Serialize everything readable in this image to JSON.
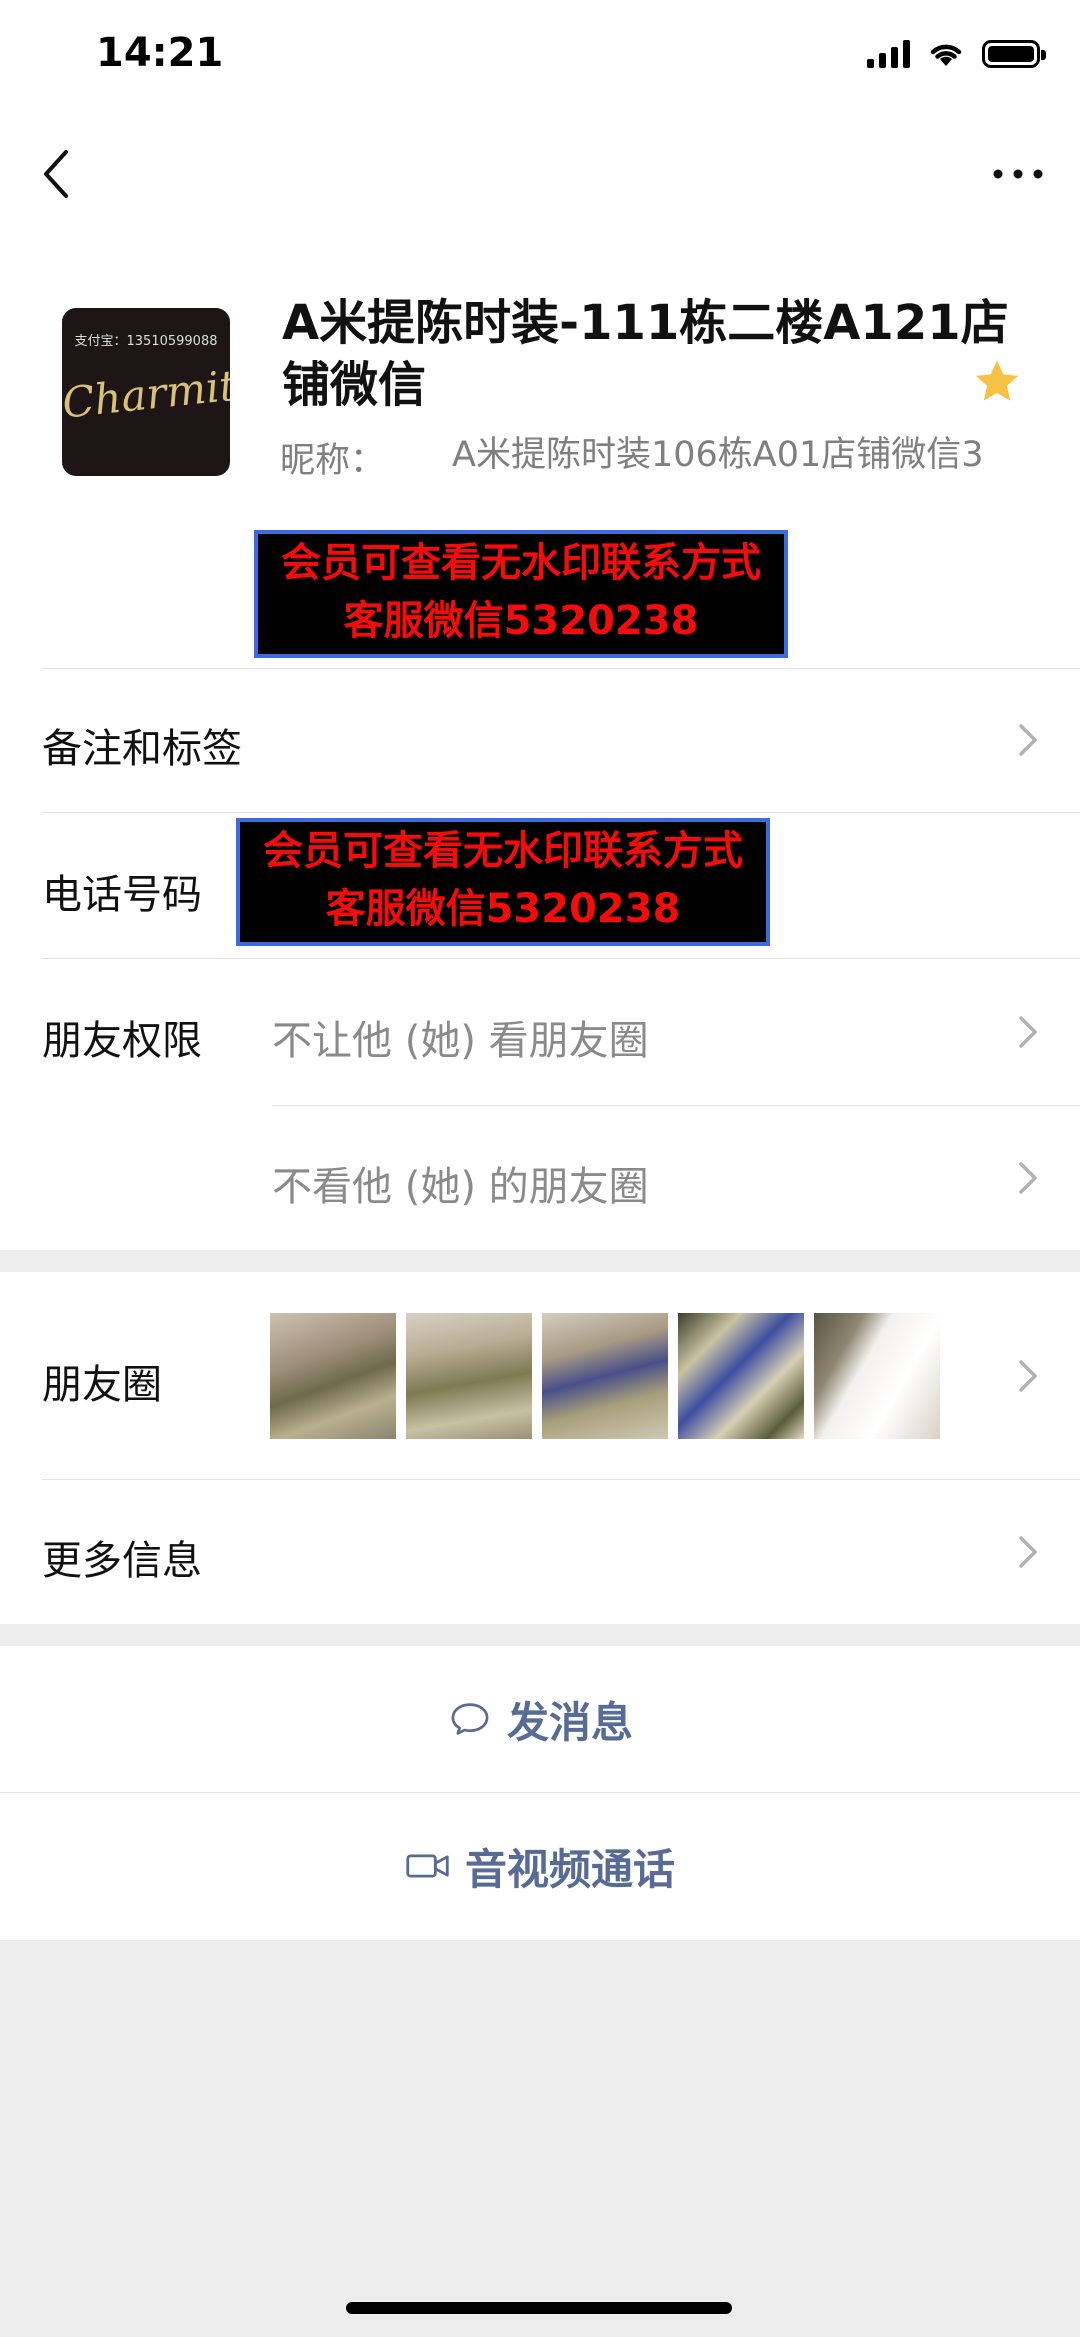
{
  "status_bar": {
    "time": "14:21"
  },
  "profile": {
    "name": "A米提陈时装-111栋二楼A121店铺微信",
    "nickname_label": "昵称：",
    "nickname": "A米提陈时装106栋A01店铺微信3",
    "avatar": {
      "top_text": "支付宝：13510599088",
      "script_text": "Charmity"
    },
    "starred": true
  },
  "watermark": {
    "line1": "会员可查看无水印联系方式",
    "line2": "客服微信5320238"
  },
  "rows": {
    "remarks": "备注和标签",
    "phone": "电话号码",
    "permissions": "朋友权限",
    "perm_hide_mine": "不让他 (她) 看朋友圈",
    "perm_hide_theirs": "不看他 (她) 的朋友圈",
    "moments": "朋友圈",
    "more_info": "更多信息"
  },
  "moments_thumbnails": [
    "dress-photo-1",
    "dress-photo-2",
    "dress-photo-3",
    "fabric-closeup",
    "clothing-tag"
  ],
  "actions": {
    "message": "发消息",
    "call": "音视频通话"
  },
  "colors": {
    "link": "#576b95",
    "star": "#f7c244",
    "watermark_text": "#f20d0d",
    "watermark_border": "#3d6ae0"
  }
}
